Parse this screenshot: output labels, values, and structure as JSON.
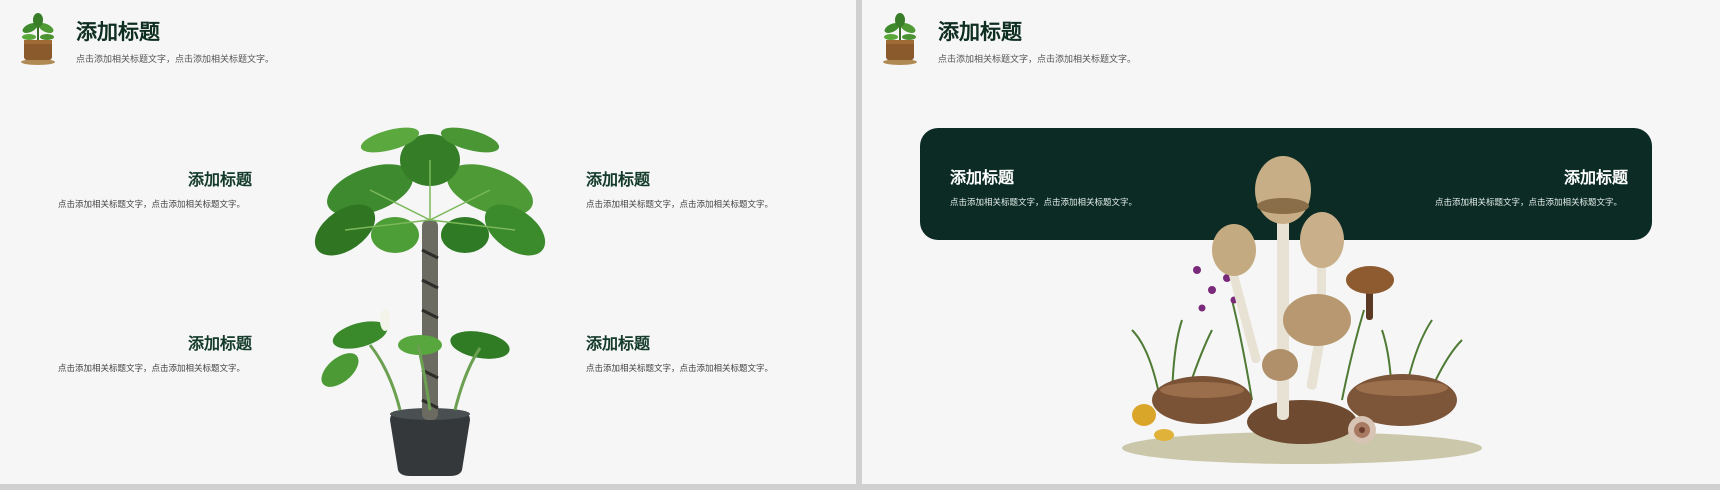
{
  "slides": [
    {
      "header": {
        "title": "添加标题",
        "subtitle": "点击添加相关标题文字，点击添加相关标题文字。"
      },
      "blocks": [
        {
          "title": "添加标题",
          "text": "点击添加相关标题文字，点击添加相关标题文字。"
        },
        {
          "title": "添加标题",
          "text": "点击添加相关标题文字，点击添加相关标题文字。"
        },
        {
          "title": "添加标题",
          "text": "点击添加相关标题文字，点击添加相关标题文字。"
        },
        {
          "title": "添加标题",
          "text": "点击添加相关标题文字，点击添加相关标题文字。"
        }
      ],
      "image_icon": "potted-plant-icon"
    },
    {
      "header": {
        "title": "添加标题",
        "subtitle": "点击添加相关标题文字，点击添加相关标题文字。"
      },
      "banner": {
        "left": {
          "title": "添加标题",
          "text": "点击添加相关标题文字，点击添加相关标题文字。"
        },
        "right": {
          "title": "添加标题",
          "text": "点击添加相关标题文字，点击添加相关标题文字。"
        }
      },
      "image_icon": "mushroom-icon"
    }
  ],
  "colors": {
    "accent": "#0b2b24",
    "title": "#143a2b",
    "background": "#f6f6f6"
  }
}
